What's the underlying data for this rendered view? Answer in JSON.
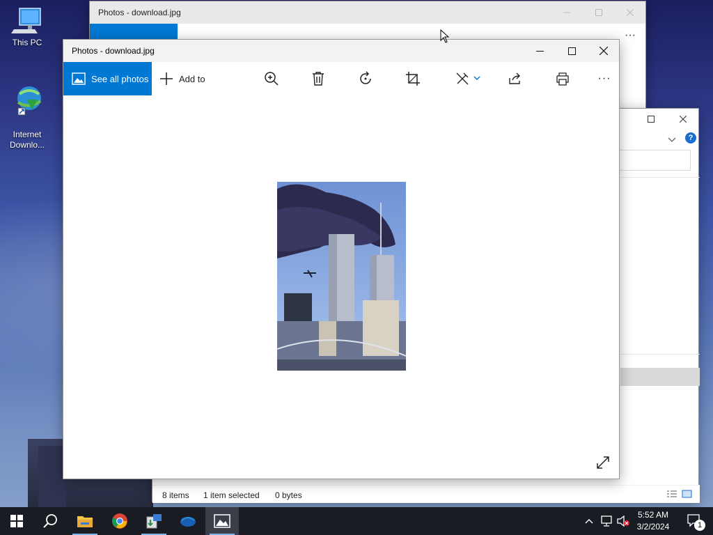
{
  "desktop": {
    "icons": [
      {
        "label": "This PC"
      },
      {
        "label": "Internet\nDownlo..."
      }
    ]
  },
  "photos_back": {
    "title": "Photos - download.jpg",
    "see_all_label": "See all photos",
    "add_to_label": "Add to"
  },
  "photos": {
    "title": "Photos - download.jpg",
    "see_all_label": "See all photos",
    "add_to_label": "Add to",
    "toolbar_icons": [
      "zoom-in-icon",
      "delete-icon",
      "rotate-icon",
      "crop-icon",
      "edit-icon",
      "share-icon",
      "print-icon",
      "more-icon"
    ]
  },
  "explorer": {
    "status_items": "8 items",
    "status_selected": "1 item selected",
    "status_size": "0 bytes"
  },
  "taskbar": {
    "time": "5:52 AM",
    "date": "3/2/2024",
    "notification_count": "1"
  },
  "colors": {
    "accent": "#0078d4",
    "taskbar": "#1a1c24"
  }
}
